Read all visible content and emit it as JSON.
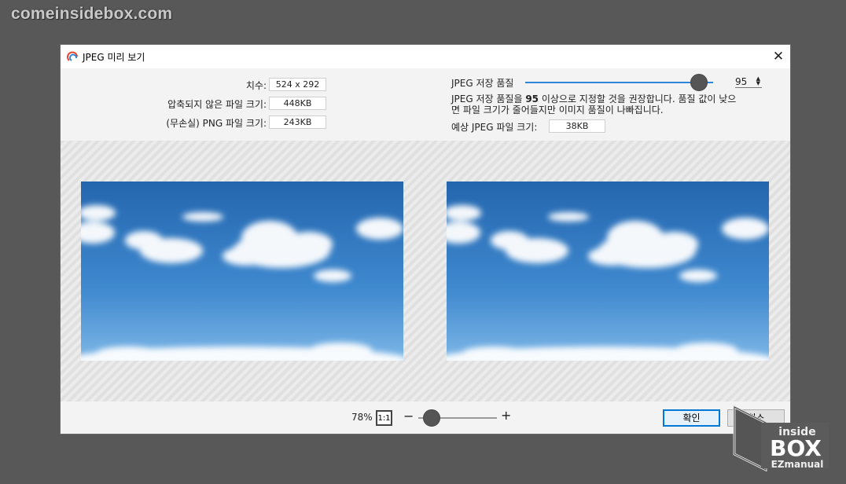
{
  "watermark": {
    "site": "comeinsidebox.com"
  },
  "dialog": {
    "title": "JPEG 미리 보기",
    "info": {
      "dimensions_label": "치수:",
      "dimensions_value": "524 x 292",
      "uncompressed_label": "압축되지 않은 파일 크기:",
      "uncompressed_value": "448KB",
      "png_label": "(무손실) PNG 파일 크기:",
      "png_value": "243KB"
    },
    "quality": {
      "label": "JPEG 저장 품질",
      "value": "95",
      "level": 95,
      "hint_prefix": "JPEG 저장 품질을 ",
      "hint_bold": "95",
      "hint_suffix": " 이상으로 지정할 것을 권장합니다. 품질 값이 낮으",
      "hint_line2": "면 파일 크기가 줄어들지만 이미지 품질이 나빠집니다.",
      "estimated_label": "예상 JPEG 파일 크기:",
      "estimated_value": "38KB"
    },
    "zoom": {
      "percent": "78%",
      "actual_size": "1:1",
      "minus": "−",
      "plus": "+"
    },
    "buttons": {
      "ok": "확인",
      "cancel": "취소"
    }
  },
  "logo": {
    "line1": "inside",
    "line2": "BOX",
    "line3": "EZmanual"
  },
  "colors": {
    "accent": "#2f86d9",
    "thumb": "#555555",
    "sky_top": "#1f5fa8",
    "sky_bottom": "#7db6e6"
  }
}
